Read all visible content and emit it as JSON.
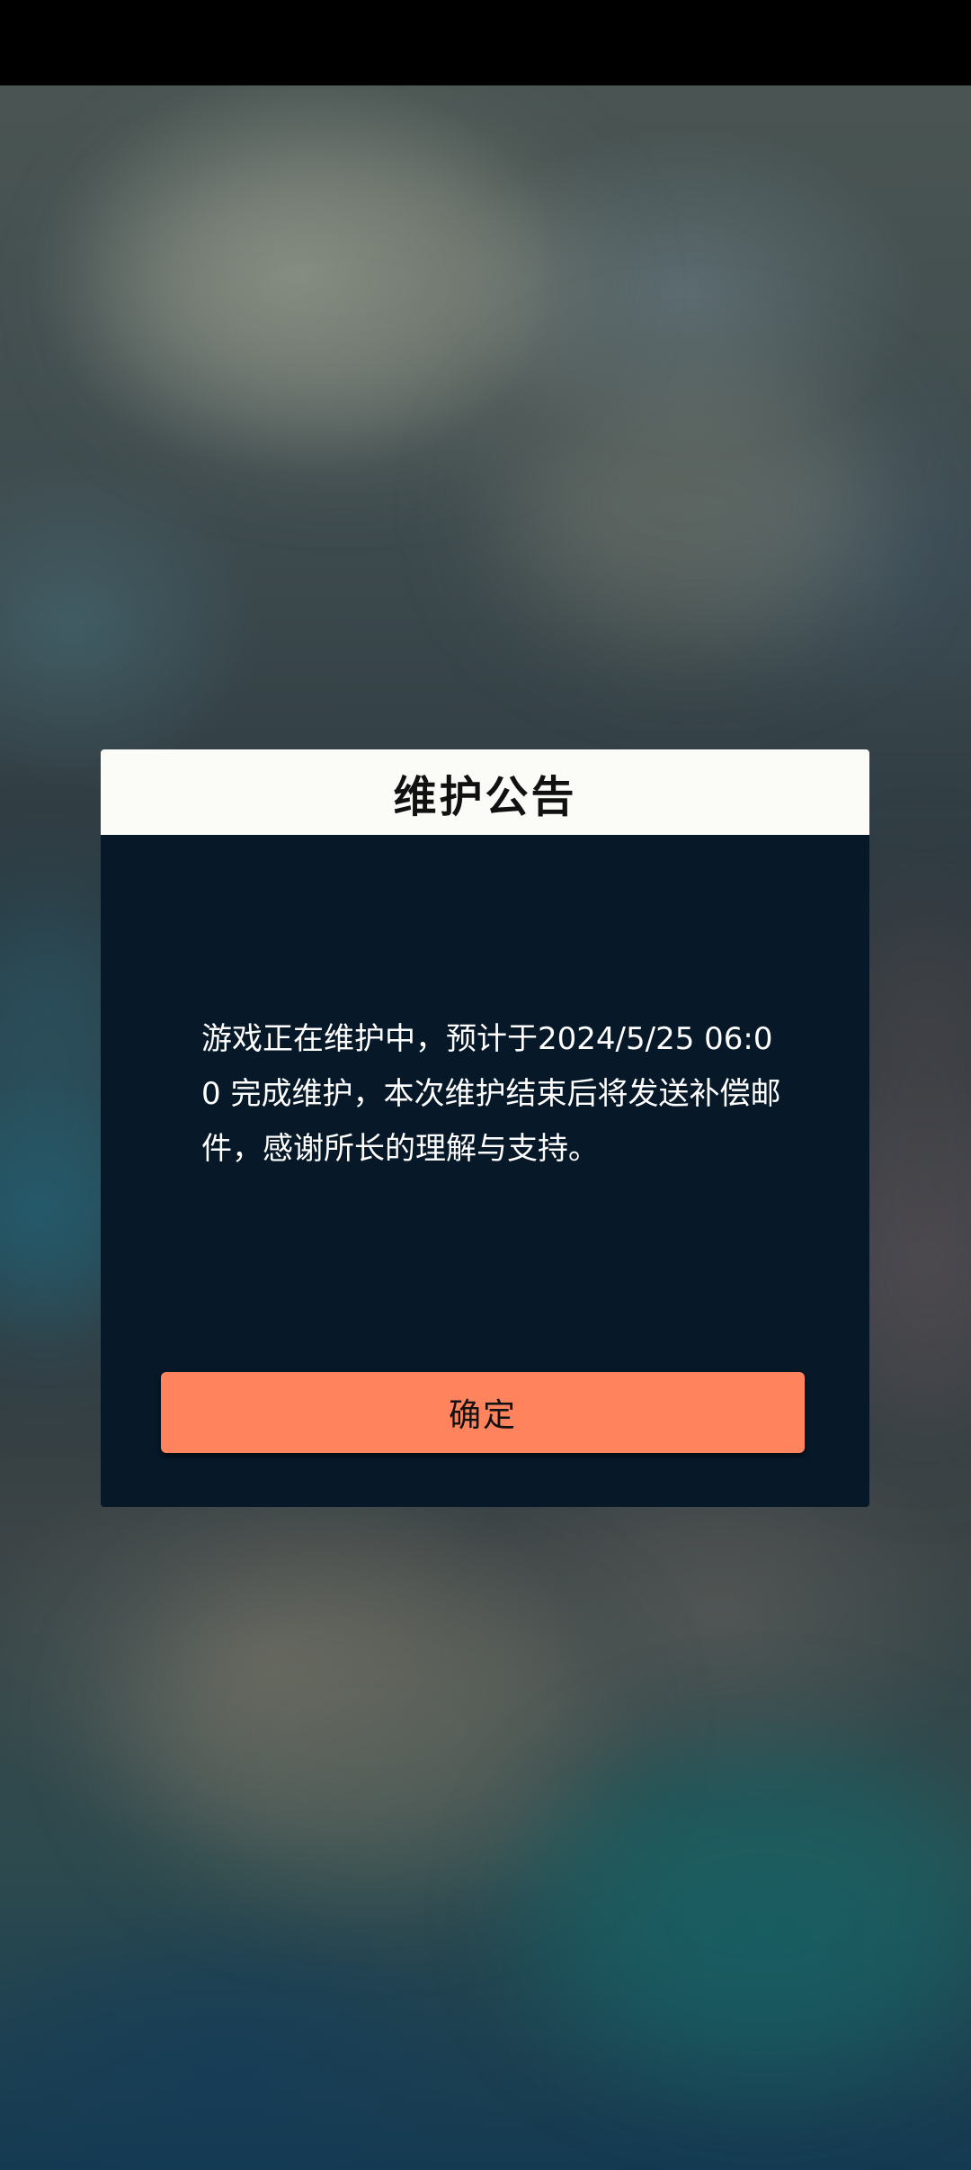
{
  "dialog": {
    "title": "维护公告",
    "message": "游戏正在维护中，预计于2024/5/25 06:00 完成维护，本次维护结束后将发送补偿邮件，感谢所长的理解与支持。",
    "confirm_label": "确定"
  },
  "colors": {
    "dialog_background": "#071828",
    "header_background": "#fbfcf8",
    "confirm_button": "#ff845e"
  }
}
